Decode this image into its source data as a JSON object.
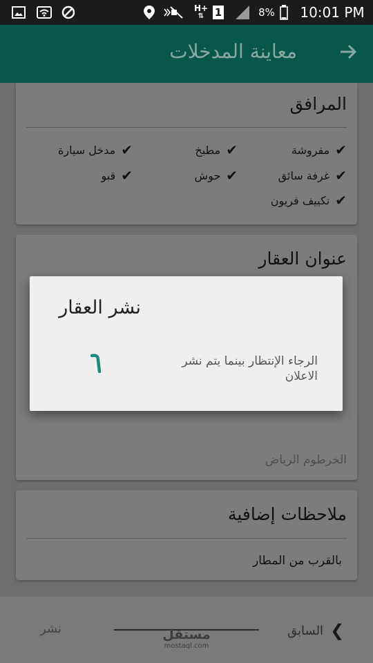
{
  "status_bar": {
    "battery": "8%",
    "time": "10:01 PM",
    "sim_slot": "1",
    "network": "H+",
    "icons": [
      "image-icon",
      "wifi-icon",
      "blocked-icon",
      "location-icon",
      "muted-icon",
      "network-h-plus-icon",
      "sim-1-icon",
      "signal-icon",
      "battery-icon"
    ]
  },
  "app_bar": {
    "title": "معاينة المدخلات",
    "back_icon": "arrow-right-icon",
    "color": "#08574b"
  },
  "amenities": {
    "title": "المرافق",
    "items": [
      {
        "label": "مفروشة"
      },
      {
        "label": "مطبخ"
      },
      {
        "label": "مدخل سيارة"
      },
      {
        "label": "غرفة سائق"
      },
      {
        "label": "حوش"
      },
      {
        "label": "قبو"
      },
      {
        "label": "تكييف فريون"
      }
    ]
  },
  "address": {
    "title": "عنوان العقار",
    "value": "الخرطوم الرياض"
  },
  "notes": {
    "title": "ملاحظات إضافية",
    "value": "بالقرب من المطار"
  },
  "bottom_nav": {
    "previous_label": "السابق",
    "publish_label": "نشر"
  },
  "watermark": {
    "arabic": "مستقل",
    "latin": "mostaql.com"
  },
  "dialog": {
    "title": "نشر العقار",
    "message": "الرجاء الإنتظار بينما يتم نشر الاعلان",
    "spinner_color": "#1c8a7e"
  }
}
